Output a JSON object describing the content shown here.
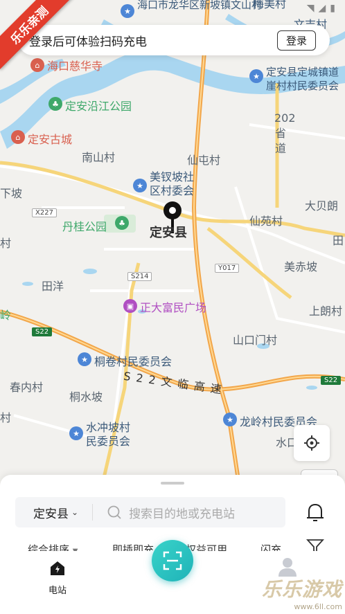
{
  "status_bar": {
    "wifi_icon": "wifi-icon",
    "signal_icon": "signal-icon",
    "battery_icon": "battery-icon"
  },
  "ribbon": {
    "text": "乐乐亲测"
  },
  "login_banner": {
    "text": "登录后可体验扫码充电",
    "button_label": "登录"
  },
  "map": {
    "labels": {
      "top_village": "海口市龙华区新坡镇文山村",
      "top_right": "梅美村",
      "haikou_cihua": "海口慈华寺",
      "dingan_river_park": "定安沿江公园",
      "dingan_ancient_city": "定安古城",
      "dingcheng_committee": "定安县定城镇道崖村村民委员会",
      "nanshan": "南山村",
      "xiantun": "仙屯村",
      "meizuopo": "美钗坡社区村委会",
      "xiapo": "下坡",
      "dangui_park": "丹桂公园",
      "dingan_county": "定安县",
      "xianyuan": "仙苑村",
      "dabeilang": "大贝朗",
      "provincial_202": "202省道",
      "meichipo": "美赤坡",
      "tianyang": "田洋",
      "zhengda_plaza": "正大富民广场",
      "shanglang": "上朗村",
      "shankoumen": "山口门村",
      "tongjuan": "桐卷村民委员会",
      "chunnei": "春内村",
      "tongshuipo": "桐水坡",
      "s22_expressway": "S22文临高速",
      "shuichongpo": "水冲坡村民委员会",
      "longling": "龙岭村民委员会",
      "shuikou": "水口",
      "right_edge_tian": "田",
      "left_edge_cun": "村",
      "left_edge_ling": "岭",
      "bottom_left_cun": "村",
      "right_top_cun": "文吉村"
    },
    "shields": {
      "x227": "X227",
      "s214": "S214",
      "y017": "Y017",
      "s22_left": "S22",
      "s22_right": "S22"
    }
  },
  "location_button": {
    "icon": "locate-icon"
  },
  "bottom_sheet": {
    "region": "定安县",
    "search_placeholder": "搜索目的地或充电站",
    "filters": [
      "综合排序",
      "即插即充",
      "权益可用",
      "闪充"
    ]
  },
  "tabbar": {
    "station_label": "电站",
    "scan_icon": "scan-icon",
    "me_icon": "user-icon"
  },
  "watermark": {
    "big": "乐乐游戏",
    "small": "www.6ll.com"
  }
}
